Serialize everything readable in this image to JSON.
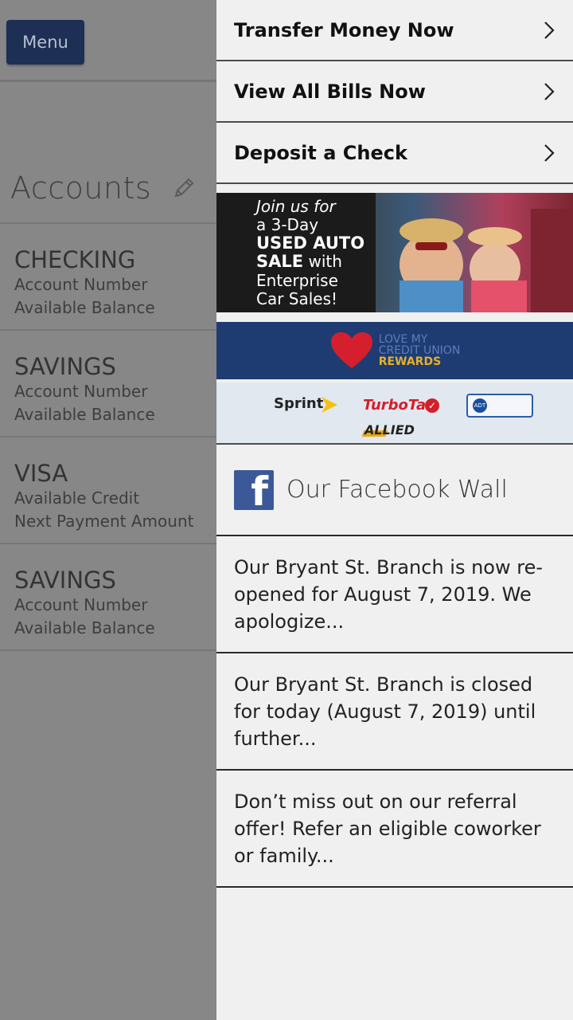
{
  "menu_button": {
    "label": "Menu"
  },
  "accounts": {
    "title": "Accounts",
    "items": [
      {
        "name": "CHECKING",
        "line1": "Account Number",
        "line2": "Available Balance"
      },
      {
        "name": "SAVINGS",
        "line1": "Account Number",
        "line2": "Available Balance"
      },
      {
        "name": "VISA",
        "line1": "Available Credit",
        "line2": "Next Payment Amount"
      },
      {
        "name": "SAVINGS",
        "line1": "Account Number",
        "line2": "Available Balance"
      }
    ]
  },
  "drawer": {
    "nav": [
      {
        "label": "Transfer Money Now"
      },
      {
        "label": "View All Bills Now"
      },
      {
        "label": "Deposit a Check"
      }
    ],
    "promo_auto": {
      "line1": "Join us for",
      "line2": "a 3-Day",
      "line3": "USED AUTO",
      "line4a": "SALE",
      "line4b": " with",
      "line5": "Enterprise",
      "line6": "Car Sales!"
    },
    "promo_rewards": {
      "line1": "LOVE MY",
      "line2": "CREDIT UNION",
      "line3": "REWARDS"
    },
    "promo_partners": {
      "sprint": "Sprint",
      "turbotax": "TurboTax",
      "adt": "ADT",
      "allied": "ALLIED"
    },
    "facebook": {
      "title": "Our Facebook Wall",
      "posts": [
        {
          "text": "Our Bryant St. Branch is now re-opened for August 7, 2019. We apologize..."
        },
        {
          "text": "Our Bryant St. Branch is closed for today (August 7, 2019) until further..."
        },
        {
          "text": "Don’t miss out on our referral offer! Refer an eligible coworker or family..."
        }
      ]
    }
  },
  "colors": {
    "menu_button_bg": "#1d2f55",
    "overlay_gray": "#878787",
    "drawer_bg": "#f0f0f0",
    "facebook_blue": "#3b5998",
    "rewards_blue": "#1f3c72"
  }
}
